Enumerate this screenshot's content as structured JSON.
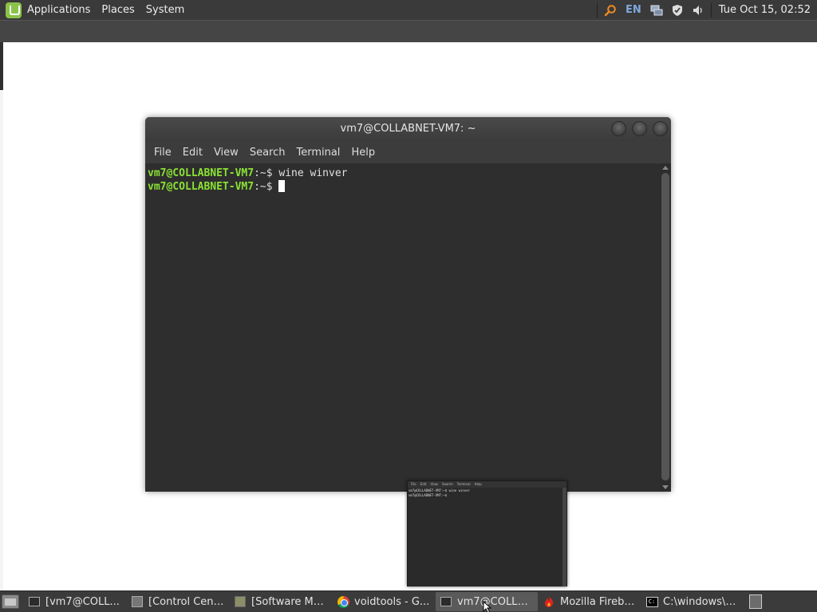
{
  "top_panel": {
    "menus": [
      "Applications",
      "Places",
      "System"
    ],
    "language": "EN",
    "clock": "Tue Oct 15, 02:52",
    "tray_icons": [
      "search-icon",
      "network-icon",
      "shield-icon",
      "volume-icon"
    ]
  },
  "terminal": {
    "title": "vm7@COLLABNET-VM7: ~",
    "menu": [
      "File",
      "Edit",
      "View",
      "Search",
      "Terminal",
      "Help"
    ],
    "lines": [
      {
        "user": "vm7@COLLABNET-VM7",
        "path": ":~$ ",
        "command": "wine winver"
      },
      {
        "user": "vm7@COLLABNET-VM7",
        "path": ":~$ ",
        "command": ""
      }
    ],
    "colors": {
      "prompt": "#8ae234",
      "background": "#2e2e2e"
    }
  },
  "preview": {
    "menu": [
      "File",
      "Edit",
      "View",
      "Search",
      "Terminal",
      "Help"
    ],
    "line1": "vm7@COLLABNET-VM7:~$ wine winver",
    "line2": "vm7@COLLABNET-VM7:~$ "
  },
  "taskbar": {
    "tasks": [
      {
        "label": "[vm7@COLL...",
        "icon": "terminal-icon",
        "active": false
      },
      {
        "label": "[Control Cent...",
        "icon": "control-center-icon",
        "active": false
      },
      {
        "label": "[Software Ma...",
        "icon": "software-manager-icon",
        "active": false
      },
      {
        "label": "voidtools - G...",
        "icon": "chrome-icon",
        "active": false
      },
      {
        "label": "vm7@COLLA...",
        "icon": "terminal-icon",
        "active": true
      },
      {
        "label": "Mozilla Firebird",
        "icon": "firebird-icon",
        "active": false
      },
      {
        "label": "C:\\windows\\s...",
        "icon": "cmd-icon",
        "active": false
      }
    ]
  }
}
